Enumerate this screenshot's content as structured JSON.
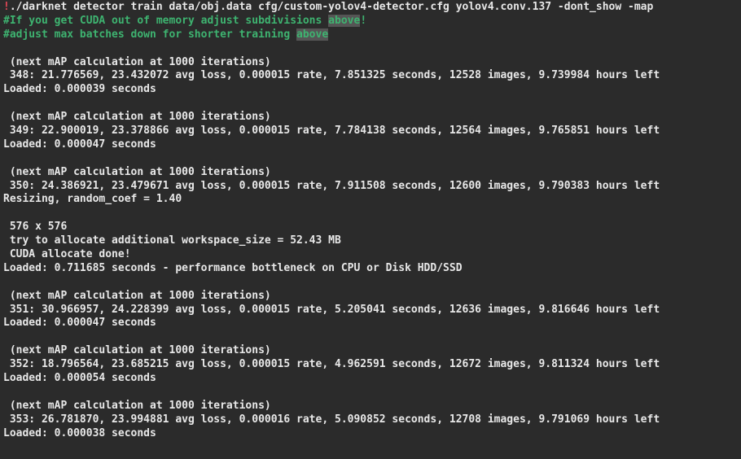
{
  "header": {
    "bang": "!",
    "cmd_rest": "./darknet detector train data/obj.data cfg/custom-yolov4-detector.cfg yolov4.conv.137 -dont_show -map"
  },
  "comments": {
    "cuda_prefix": "#If you get CUDA out of memory adjust subdivisions ",
    "cuda_highlight": "above",
    "cuda_suffix": "!",
    "maxb_prefix": "#adjust max batches down for shorter training ",
    "maxb_highlight": "above"
  },
  "blocks": [
    {
      "next": " (next mAP calculation at 1000 iterations)",
      "stats": " 348: 21.776569, 23.432072 avg loss, 0.000015 rate, 7.851325 seconds, 12528 images, 9.739984 hours left",
      "loaded": "Loaded: 0.000039 seconds"
    },
    {
      "next": " (next mAP calculation at 1000 iterations)",
      "stats": " 349: 22.900019, 23.378866 avg loss, 0.000015 rate, 7.784138 seconds, 12564 images, 9.765851 hours left",
      "loaded": "Loaded: 0.000047 seconds"
    },
    {
      "next": " (next mAP calculation at 1000 iterations)",
      "stats": " 350: 24.386921, 23.479671 avg loss, 0.000015 rate, 7.911508 seconds, 12600 images, 9.790383 hours left",
      "loaded": "Resizing, random_coef = 1.40"
    }
  ],
  "alloc": {
    "dims": " 576 x 576",
    "try": " try to allocate additional workspace_size = 52.43 MB",
    "done": " CUDA allocate done!",
    "loaded": "Loaded: 0.711685 seconds - performance bottleneck on CPU or Disk HDD/SSD"
  },
  "blocks2": [
    {
      "next": " (next mAP calculation at 1000 iterations)",
      "stats": " 351: 30.966957, 24.228399 avg loss, 0.000015 rate, 5.205041 seconds, 12636 images, 9.816646 hours left",
      "loaded": "Loaded: 0.000047 seconds"
    },
    {
      "next": " (next mAP calculation at 1000 iterations)",
      "stats": " 352: 18.796564, 23.685215 avg loss, 0.000015 rate, 4.962591 seconds, 12672 images, 9.811324 hours left",
      "loaded": "Loaded: 0.000054 seconds"
    },
    {
      "next": " (next mAP calculation at 1000 iterations)",
      "stats": " 353: 26.781870, 23.994881 avg loss, 0.000016 rate, 5.090852 seconds, 12708 images, 9.791069 hours left",
      "loaded": "Loaded: 0.000038 seconds"
    }
  ]
}
